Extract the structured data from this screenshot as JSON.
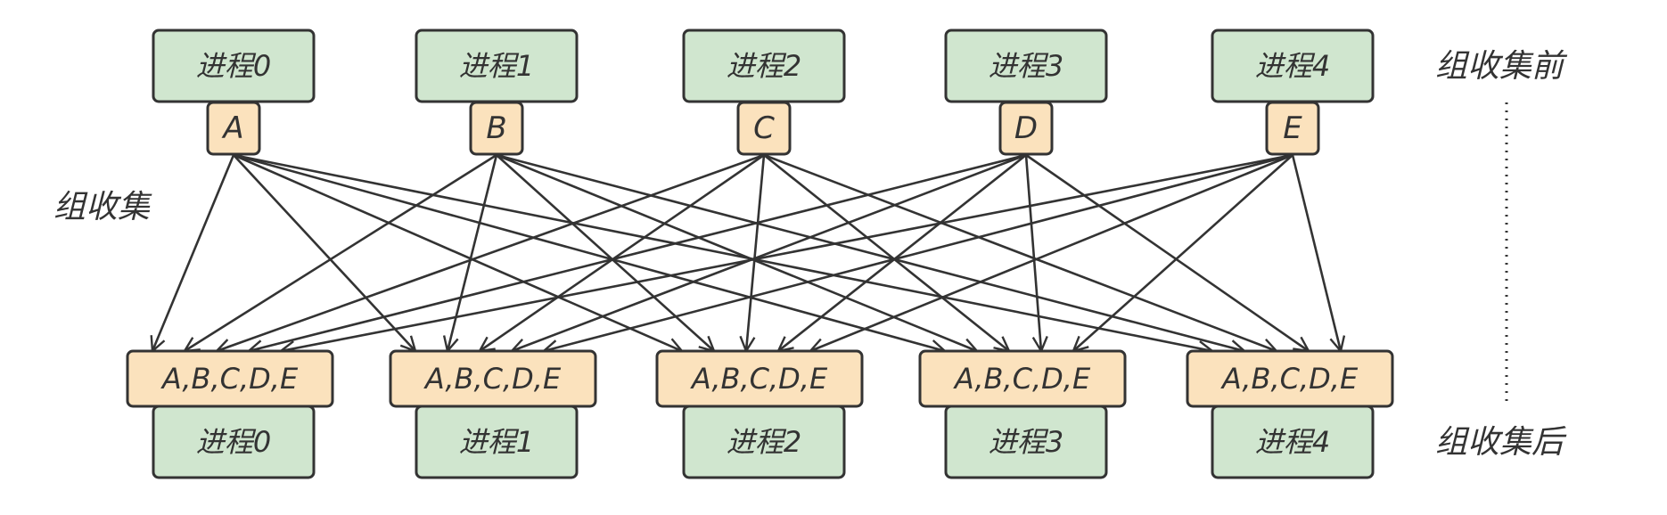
{
  "colors": {
    "process_fill": "#d0e6cf",
    "data_fill": "#fbe2bd",
    "stroke": "#333333",
    "arrow": "#333333"
  },
  "labels": {
    "before": "组收集前",
    "after": "组收集后",
    "operation": "组收集"
  },
  "top_processes": [
    "进程0",
    "进程1",
    "进程2",
    "进程3",
    "进程4"
  ],
  "inputs": [
    "A",
    "B",
    "C",
    "D",
    "E"
  ],
  "outputs": [
    "A,B,C,D,E",
    "A,B,C,D,E",
    "A,B,C,D,E",
    "A,B,C,D,E",
    "A,B,C,D,E"
  ],
  "bottom_processes": [
    "进程0",
    "进程1",
    "进程2",
    "进程3",
    "进程4"
  ]
}
